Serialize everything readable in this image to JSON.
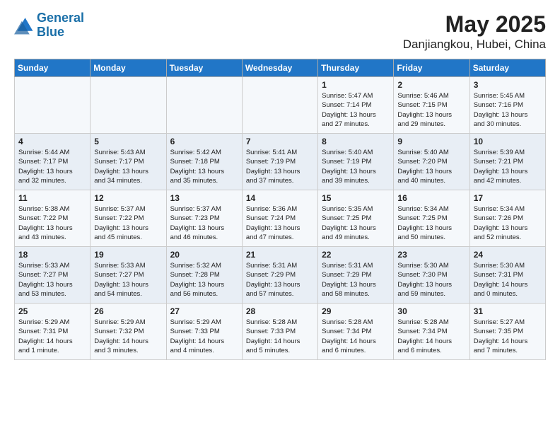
{
  "header": {
    "logo_line1": "General",
    "logo_line2": "Blue",
    "month": "May 2025",
    "location": "Danjiangkou, Hubei, China"
  },
  "weekdays": [
    "Sunday",
    "Monday",
    "Tuesday",
    "Wednesday",
    "Thursday",
    "Friday",
    "Saturday"
  ],
  "weeks": [
    [
      {
        "day": "",
        "text": ""
      },
      {
        "day": "",
        "text": ""
      },
      {
        "day": "",
        "text": ""
      },
      {
        "day": "",
        "text": ""
      },
      {
        "day": "1",
        "text": "Sunrise: 5:47 AM\nSunset: 7:14 PM\nDaylight: 13 hours\nand 27 minutes."
      },
      {
        "day": "2",
        "text": "Sunrise: 5:46 AM\nSunset: 7:15 PM\nDaylight: 13 hours\nand 29 minutes."
      },
      {
        "day": "3",
        "text": "Sunrise: 5:45 AM\nSunset: 7:16 PM\nDaylight: 13 hours\nand 30 minutes."
      }
    ],
    [
      {
        "day": "4",
        "text": "Sunrise: 5:44 AM\nSunset: 7:17 PM\nDaylight: 13 hours\nand 32 minutes."
      },
      {
        "day": "5",
        "text": "Sunrise: 5:43 AM\nSunset: 7:17 PM\nDaylight: 13 hours\nand 34 minutes."
      },
      {
        "day": "6",
        "text": "Sunrise: 5:42 AM\nSunset: 7:18 PM\nDaylight: 13 hours\nand 35 minutes."
      },
      {
        "day": "7",
        "text": "Sunrise: 5:41 AM\nSunset: 7:19 PM\nDaylight: 13 hours\nand 37 minutes."
      },
      {
        "day": "8",
        "text": "Sunrise: 5:40 AM\nSunset: 7:19 PM\nDaylight: 13 hours\nand 39 minutes."
      },
      {
        "day": "9",
        "text": "Sunrise: 5:40 AM\nSunset: 7:20 PM\nDaylight: 13 hours\nand 40 minutes."
      },
      {
        "day": "10",
        "text": "Sunrise: 5:39 AM\nSunset: 7:21 PM\nDaylight: 13 hours\nand 42 minutes."
      }
    ],
    [
      {
        "day": "11",
        "text": "Sunrise: 5:38 AM\nSunset: 7:22 PM\nDaylight: 13 hours\nand 43 minutes."
      },
      {
        "day": "12",
        "text": "Sunrise: 5:37 AM\nSunset: 7:22 PM\nDaylight: 13 hours\nand 45 minutes."
      },
      {
        "day": "13",
        "text": "Sunrise: 5:37 AM\nSunset: 7:23 PM\nDaylight: 13 hours\nand 46 minutes."
      },
      {
        "day": "14",
        "text": "Sunrise: 5:36 AM\nSunset: 7:24 PM\nDaylight: 13 hours\nand 47 minutes."
      },
      {
        "day": "15",
        "text": "Sunrise: 5:35 AM\nSunset: 7:25 PM\nDaylight: 13 hours\nand 49 minutes."
      },
      {
        "day": "16",
        "text": "Sunrise: 5:34 AM\nSunset: 7:25 PM\nDaylight: 13 hours\nand 50 minutes."
      },
      {
        "day": "17",
        "text": "Sunrise: 5:34 AM\nSunset: 7:26 PM\nDaylight: 13 hours\nand 52 minutes."
      }
    ],
    [
      {
        "day": "18",
        "text": "Sunrise: 5:33 AM\nSunset: 7:27 PM\nDaylight: 13 hours\nand 53 minutes."
      },
      {
        "day": "19",
        "text": "Sunrise: 5:33 AM\nSunset: 7:27 PM\nDaylight: 13 hours\nand 54 minutes."
      },
      {
        "day": "20",
        "text": "Sunrise: 5:32 AM\nSunset: 7:28 PM\nDaylight: 13 hours\nand 56 minutes."
      },
      {
        "day": "21",
        "text": "Sunrise: 5:31 AM\nSunset: 7:29 PM\nDaylight: 13 hours\nand 57 minutes."
      },
      {
        "day": "22",
        "text": "Sunrise: 5:31 AM\nSunset: 7:29 PM\nDaylight: 13 hours\nand 58 minutes."
      },
      {
        "day": "23",
        "text": "Sunrise: 5:30 AM\nSunset: 7:30 PM\nDaylight: 13 hours\nand 59 minutes."
      },
      {
        "day": "24",
        "text": "Sunrise: 5:30 AM\nSunset: 7:31 PM\nDaylight: 14 hours\nand 0 minutes."
      }
    ],
    [
      {
        "day": "25",
        "text": "Sunrise: 5:29 AM\nSunset: 7:31 PM\nDaylight: 14 hours\nand 1 minute."
      },
      {
        "day": "26",
        "text": "Sunrise: 5:29 AM\nSunset: 7:32 PM\nDaylight: 14 hours\nand 3 minutes."
      },
      {
        "day": "27",
        "text": "Sunrise: 5:29 AM\nSunset: 7:33 PM\nDaylight: 14 hours\nand 4 minutes."
      },
      {
        "day": "28",
        "text": "Sunrise: 5:28 AM\nSunset: 7:33 PM\nDaylight: 14 hours\nand 5 minutes."
      },
      {
        "day": "29",
        "text": "Sunrise: 5:28 AM\nSunset: 7:34 PM\nDaylight: 14 hours\nand 6 minutes."
      },
      {
        "day": "30",
        "text": "Sunrise: 5:28 AM\nSunset: 7:34 PM\nDaylight: 14 hours\nand 6 minutes."
      },
      {
        "day": "31",
        "text": "Sunrise: 5:27 AM\nSunset: 7:35 PM\nDaylight: 14 hours\nand 7 minutes."
      }
    ]
  ]
}
